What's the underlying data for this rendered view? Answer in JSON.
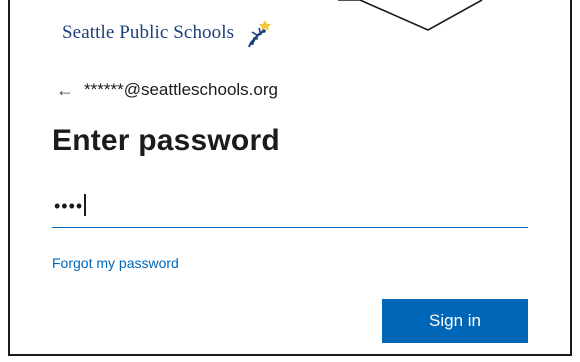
{
  "brand": {
    "name": "Seattle Public Schools",
    "logo_icon": "seattle-public-schools-logo-mark",
    "color": "#1f3f7a"
  },
  "account": {
    "back_icon": "back-arrow-icon",
    "email": "******@seattleschools.org"
  },
  "page": {
    "title": "Enter password"
  },
  "password": {
    "value": "••••"
  },
  "links": {
    "forgot": "Forgot my password"
  },
  "actions": {
    "sign_in_label": "Sign in"
  },
  "colors": {
    "accent": "#0067b8",
    "text": "#1b1b1b",
    "border": "#1a1a1a"
  }
}
